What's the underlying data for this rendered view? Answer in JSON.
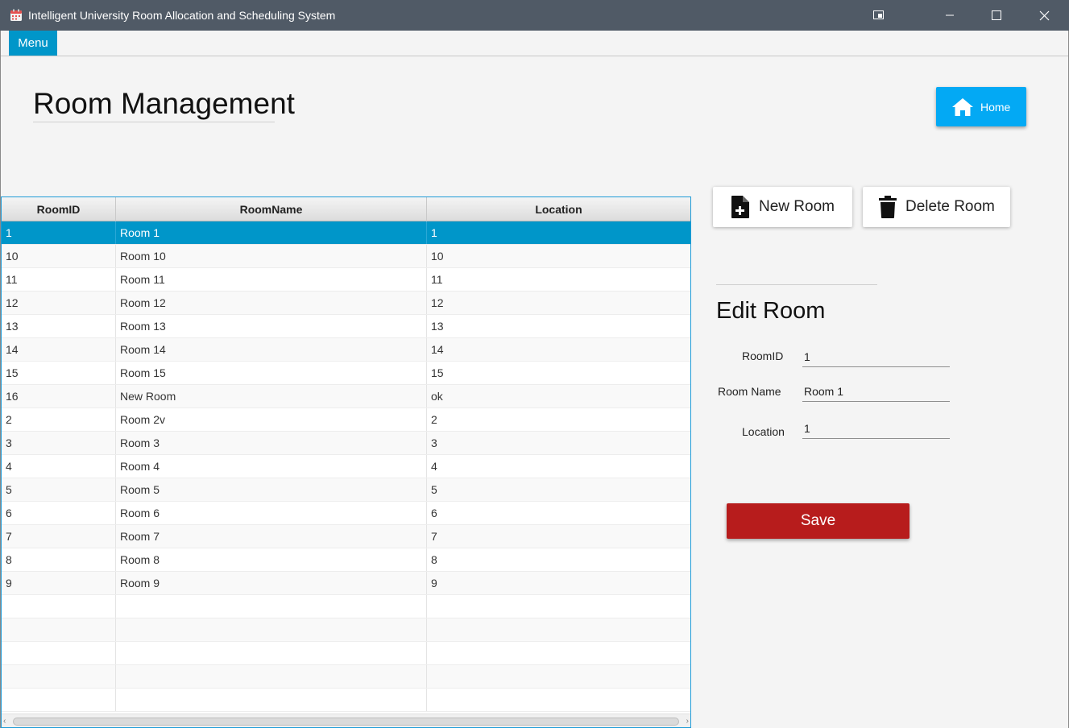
{
  "window": {
    "title": "Intelligent University Room Allocation and Scheduling System",
    "titlebar_bg": "#505a66"
  },
  "menu": {
    "label": "Menu"
  },
  "page": {
    "title": "Room Management"
  },
  "home_button": {
    "label": "Home",
    "icon": "home-icon",
    "color": "#03a9f4"
  },
  "table": {
    "columns": [
      "RoomID",
      "RoomName",
      "Location"
    ],
    "selected_index": 0,
    "rows": [
      [
        "1",
        "Room 1",
        "1"
      ],
      [
        "10",
        "Room 10",
        "10"
      ],
      [
        "11",
        "Room 11",
        "11"
      ],
      [
        "12",
        "Room 12",
        "12"
      ],
      [
        "13",
        "Room 13",
        "13"
      ],
      [
        "14",
        "Room 14",
        "14"
      ],
      [
        "15",
        "Room 15",
        "15"
      ],
      [
        "16",
        "New Room",
        "ok"
      ],
      [
        "2",
        "Room 2v",
        "2"
      ],
      [
        "3",
        "Room 3",
        "3"
      ],
      [
        "4",
        "Room 4",
        "4"
      ],
      [
        "5",
        "Room 5",
        "5"
      ],
      [
        "6",
        "Room 6",
        "6"
      ],
      [
        "7",
        "Room 7",
        "7"
      ],
      [
        "8",
        "Room 8",
        "8"
      ],
      [
        "9",
        "Room 9",
        "9"
      ]
    ],
    "empty_rows": 5,
    "selection_color": "#0096c9"
  },
  "actions": {
    "new_room": {
      "label": "New Room",
      "icon": "add-file-icon"
    },
    "delete_room": {
      "label": "Delete Room",
      "icon": "trash-icon"
    }
  },
  "edit_form": {
    "title": "Edit Room",
    "fields": {
      "room_id": {
        "label": "RoomID",
        "value": "1"
      },
      "room_name": {
        "label": "Room Name",
        "value": "Room 1"
      },
      "location": {
        "label": "Location",
        "value": "1"
      }
    },
    "save_label": "Save",
    "save_color": "#b71c1c"
  }
}
